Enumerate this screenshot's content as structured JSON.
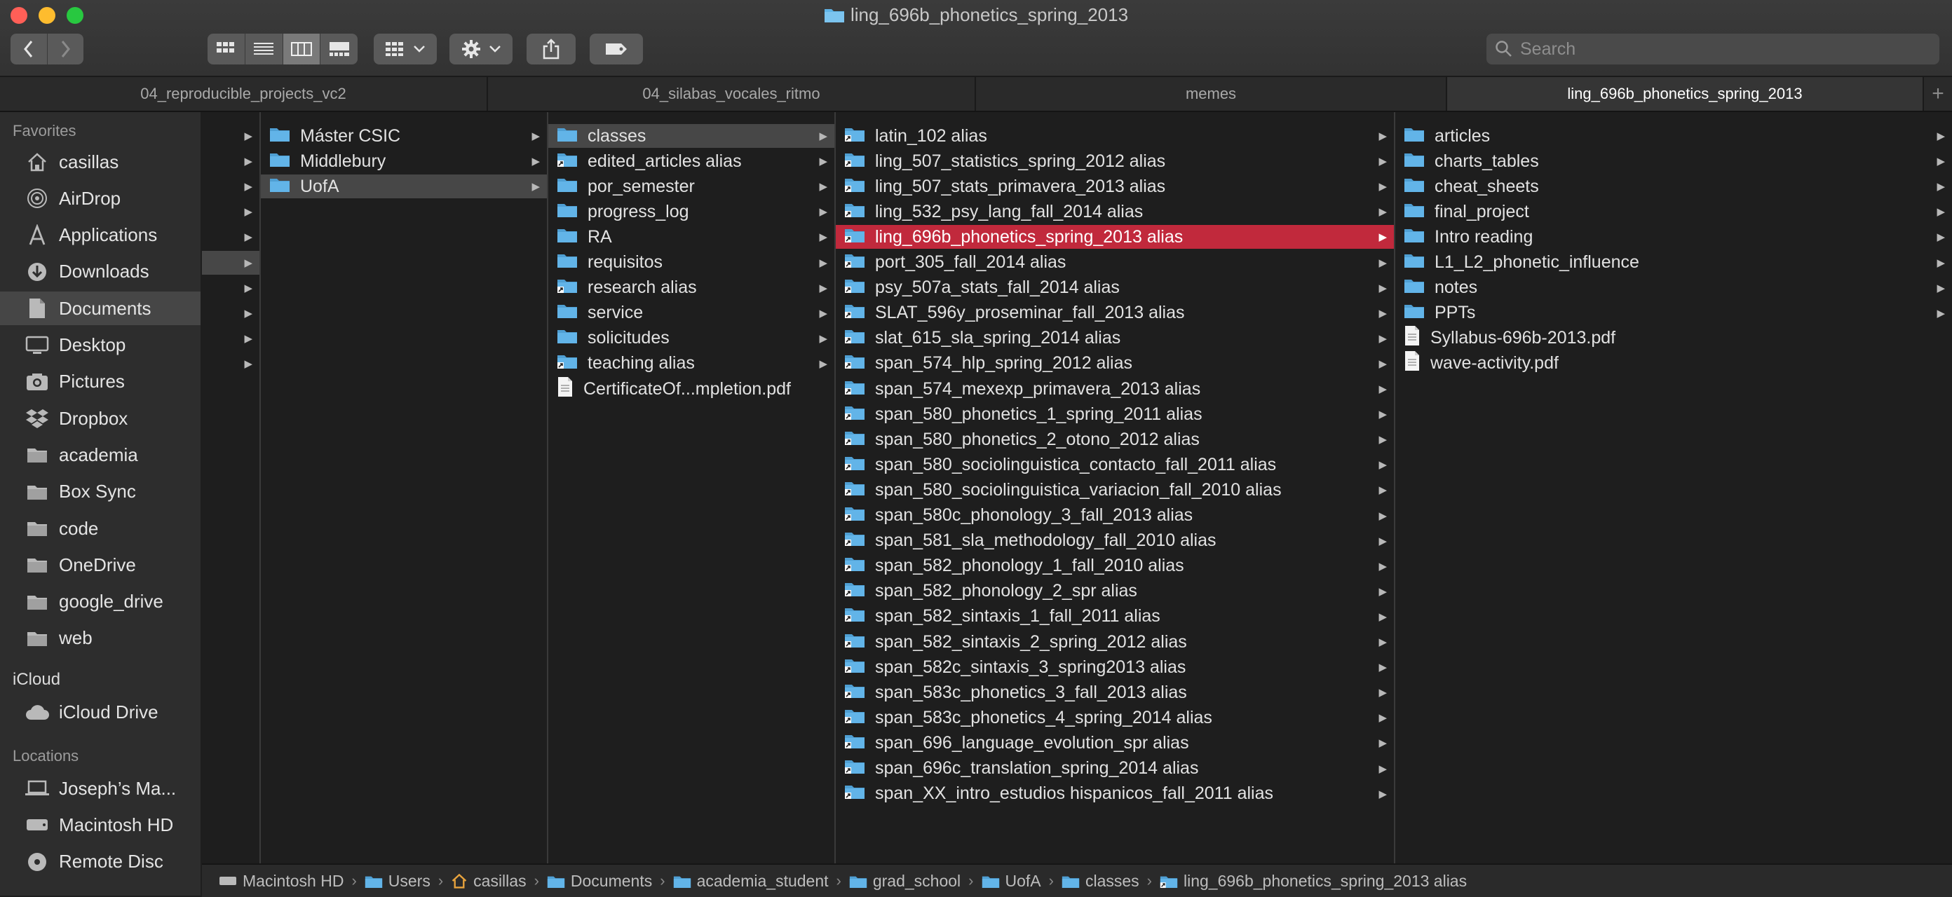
{
  "window": {
    "title": "ling_696b_phonetics_spring_2013"
  },
  "search": {
    "placeholder": "Search"
  },
  "tabs": [
    {
      "label": "04_reproducible_projects_vc2",
      "active": false
    },
    {
      "label": "04_silabas_vocales_ritmo",
      "active": false
    },
    {
      "label": "memes",
      "active": false
    },
    {
      "label": "ling_696b_phonetics_spring_2013",
      "active": true
    }
  ],
  "sidebar": {
    "favorites_label": "Favorites",
    "favorites": [
      {
        "label": "casillas",
        "icon": "home-icon"
      },
      {
        "label": "AirDrop",
        "icon": "airdrop-icon"
      },
      {
        "label": "Applications",
        "icon": "applications-icon"
      },
      {
        "label": "Downloads",
        "icon": "downloads-icon"
      },
      {
        "label": "Documents",
        "icon": "documents-icon",
        "selected": true
      },
      {
        "label": "Desktop",
        "icon": "desktop-icon"
      },
      {
        "label": "Pictures",
        "icon": "pictures-icon"
      },
      {
        "label": "Dropbox",
        "icon": "dropbox-icon"
      },
      {
        "label": "academia",
        "icon": "folder-icon"
      },
      {
        "label": "Box Sync",
        "icon": "folder-icon"
      },
      {
        "label": "code",
        "icon": "folder-icon"
      },
      {
        "label": "OneDrive",
        "icon": "folder-icon"
      },
      {
        "label": "google_drive",
        "icon": "folder-icon"
      },
      {
        "label": "web",
        "icon": "folder-icon"
      }
    ],
    "icloud_label": "iCloud",
    "icloud": [
      {
        "label": "iCloud Drive",
        "icon": "cloud-icon"
      }
    ],
    "locations_label": "Locations",
    "locations": [
      {
        "label": "Joseph’s Ma...",
        "icon": "laptop-icon"
      },
      {
        "label": "Macintosh HD",
        "icon": "hard-drive-icon"
      },
      {
        "label": "Remote Disc",
        "icon": "disc-icon"
      }
    ]
  },
  "columns": {
    "col2": [
      {
        "label": "Máster CSIC"
      },
      {
        "label": "Middlebury"
      },
      {
        "label": "UofA",
        "selected": true
      }
    ],
    "col3": [
      {
        "label": "classes",
        "kind": "folder",
        "selected": true
      },
      {
        "label": "edited_articles alias",
        "kind": "alias"
      },
      {
        "label": "por_semester",
        "kind": "folder"
      },
      {
        "label": "progress_log",
        "kind": "folder"
      },
      {
        "label": "RA",
        "kind": "folder"
      },
      {
        "label": "requisitos",
        "kind": "folder"
      },
      {
        "label": "research alias",
        "kind": "alias"
      },
      {
        "label": "service",
        "kind": "folder"
      },
      {
        "label": "solicitudes",
        "kind": "folder"
      },
      {
        "label": "teaching alias",
        "kind": "alias"
      },
      {
        "label": "CertificateOf...mpletion.pdf",
        "kind": "pdf"
      }
    ],
    "col4": [
      {
        "label": "latin_102 alias"
      },
      {
        "label": "ling_507_statistics_spring_2012 alias"
      },
      {
        "label": "ling_507_stats_primavera_2013 alias"
      },
      {
        "label": "ling_532_psy_lang_fall_2014 alias"
      },
      {
        "label": "ling_696b_phonetics_spring_2013 alias",
        "selected": true
      },
      {
        "label": "port_305_fall_2014 alias"
      },
      {
        "label": "psy_507a_stats_fall_2014 alias"
      },
      {
        "label": "SLAT_596y_proseminar_fall_2013 alias"
      },
      {
        "label": "slat_615_sla_spring_2014 alias"
      },
      {
        "label": "span_574_hlp_spring_2012 alias"
      },
      {
        "label": "span_574_mexexp_primavera_2013 alias"
      },
      {
        "label": "span_580_phonetics_1_spring_2011 alias"
      },
      {
        "label": "span_580_phonetics_2_otono_2012 alias"
      },
      {
        "label": "span_580_sociolinguistica_contacto_fall_2011 alias"
      },
      {
        "label": "span_580_sociolinguistica_variacion_fall_2010 alias"
      },
      {
        "label": "span_580c_phonology_3_fall_2013 alias"
      },
      {
        "label": "span_581_sla_methodology_fall_2010 alias"
      },
      {
        "label": "span_582_phonology_1_fall_2010 alias"
      },
      {
        "label": "span_582_phonology_2_spr alias"
      },
      {
        "label": "span_582_sintaxis_1_fall_2011 alias"
      },
      {
        "label": "span_582_sintaxis_2_spring_2012 alias"
      },
      {
        "label": "span_582c_sintaxis_3_spring2013 alias"
      },
      {
        "label": "span_583c_phonetics_3_fall_2013 alias"
      },
      {
        "label": "span_583c_phonetics_4_spring_2014 alias"
      },
      {
        "label": "span_696_language_evolution_spr alias"
      },
      {
        "label": "span_696c_translation_spring_2014 alias"
      },
      {
        "label": "span_XX_intro_estudios hispanicos_fall_2011 alias"
      }
    ],
    "col5": [
      {
        "label": "articles",
        "kind": "folder"
      },
      {
        "label": "charts_tables",
        "kind": "folder"
      },
      {
        "label": "cheat_sheets",
        "kind": "folder"
      },
      {
        "label": "final_project",
        "kind": "folder"
      },
      {
        "label": "Intro reading",
        "kind": "folder"
      },
      {
        "label": "L1_L2_phonetic_influence",
        "kind": "folder"
      },
      {
        "label": "notes",
        "kind": "folder"
      },
      {
        "label": "PPTs",
        "kind": "folder"
      },
      {
        "label": "Syllabus-696b-2013.pdf",
        "kind": "pdf"
      },
      {
        "label": "wave-activity.pdf",
        "kind": "pdf"
      }
    ]
  },
  "pathbar": [
    {
      "label": "Macintosh HD",
      "icon": "hard-drive-icon"
    },
    {
      "label": "Users",
      "icon": "users-folder-icon"
    },
    {
      "label": "casillas",
      "icon": "home-icon"
    },
    {
      "label": "Documents",
      "icon": "documents-folder-icon"
    },
    {
      "label": "academia_student",
      "icon": "folder-icon"
    },
    {
      "label": "grad_school",
      "icon": "folder-icon"
    },
    {
      "label": "UofA",
      "icon": "folder-icon"
    },
    {
      "label": "classes",
      "icon": "folder-icon"
    },
    {
      "label": "ling_696b_phonetics_spring_2013 alias",
      "icon": "alias-folder-icon"
    }
  ],
  "colors": {
    "folder": "#5fb3e6",
    "selection_red": "#c1293c",
    "selection_gray": "#474747",
    "sidebar_bg": "#2d2d2d",
    "window_bg": "#1e1e1e"
  }
}
